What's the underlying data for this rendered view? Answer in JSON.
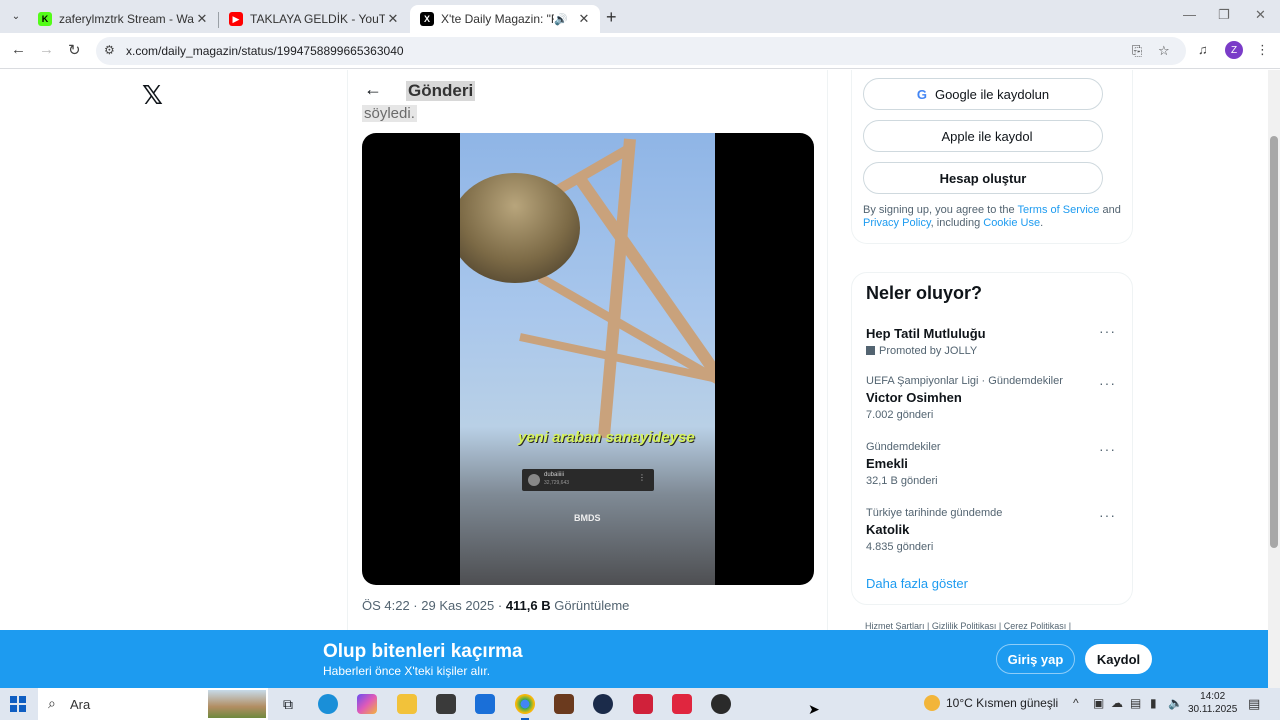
{
  "browser": {
    "tabs": [
      {
        "title": "zaferylmztrk Stream - Watch Liv",
        "favicon_color": "#53fc18",
        "favicon_char": "K"
      },
      {
        "title": "TAKLAYA GELDİK - YouTube",
        "favicon_color": "#ff0000",
        "favicon_char": "▶"
      },
      {
        "title": "X'te Daily Magazin: \"Rapçi ",
        "favicon_color": "#000000",
        "favicon_char": "X"
      }
    ],
    "url": "x.com/daily_magazin/status/1994758899665363040",
    "profile_initial": "Z"
  },
  "post": {
    "header_title": "Gönderi",
    "blurred_text": "söyledi.",
    "video_caption": "yeni araban sanayideyse",
    "video_watermark": "BMDS",
    "video_card_name": "dubaiiiii",
    "video_card_sub": "32,729,643",
    "meta_time": "ÖS 4:22 · 29 Kas 2025 · ",
    "meta_views_count": "411,6 B",
    "meta_views_label": " Görüntüleme"
  },
  "signup": {
    "google_label": "Google ile kaydolun",
    "apple_label": "Apple ile kaydol",
    "create_label": "Hesap oluştur",
    "terms_prefix": "By signing up, you agree to the ",
    "terms_link": "Terms of Service",
    "terms_and": " and ",
    "privacy_link": "Privacy Policy",
    "terms_including": ", including ",
    "cookie_link": "Cookie Use",
    "terms_end": "."
  },
  "trends": {
    "title": "Neler oluyor?",
    "items": [
      {
        "name": "Hep Tatil Mutluluğu",
        "promo": "Promoted by JOLLY"
      },
      {
        "context": "UEFA Şampiyonlar Ligi · Gündemdekiler",
        "name": "Victor Osimhen",
        "count": "7.002 gönderi"
      },
      {
        "context": "Gündemdekiler",
        "name": "Emekli",
        "count": "32,1 B gönderi"
      },
      {
        "context": "Türkiye tarihinde gündemde",
        "name": "Katolik",
        "count": "4.835 gönderi"
      }
    ],
    "show_more": "Daha fazla göster"
  },
  "footer_links": "Hizmet Şartları  |  Gizlilik Politikası  |  Çerez Politikası  |",
  "banner": {
    "title": "Olup bitenleri kaçırma",
    "subtitle": "Haberleri önce X'teki kişiler alır.",
    "login_label": "Giriş yap",
    "signup_label": "Kaydol"
  },
  "taskbar": {
    "search_label": "Ara",
    "weather": "10°C  Kısmen güneşli",
    "time": "14:02",
    "date": "30.11.2025"
  }
}
